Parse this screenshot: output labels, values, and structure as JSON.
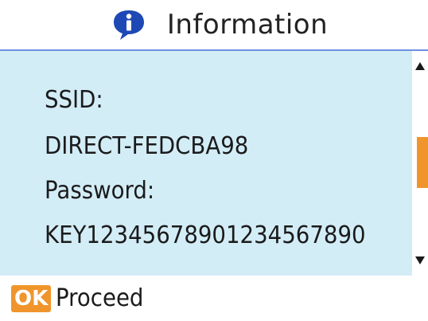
{
  "header": {
    "icon": "info-speech-bubble-icon",
    "title": "Information"
  },
  "content": {
    "ssid_label": "SSID:",
    "ssid_value": "DIRECT-FEDCBA98",
    "password_label": "Password:",
    "password_value": "KEY12345678901234567890"
  },
  "footer": {
    "ok_label": "OK",
    "proceed_label": "Proceed"
  },
  "colors": {
    "title_rule": "#6f8fe0",
    "content_bg": "#d3edf7",
    "accent_orange": "#f0952c",
    "icon_blue": "#1e49b5"
  }
}
